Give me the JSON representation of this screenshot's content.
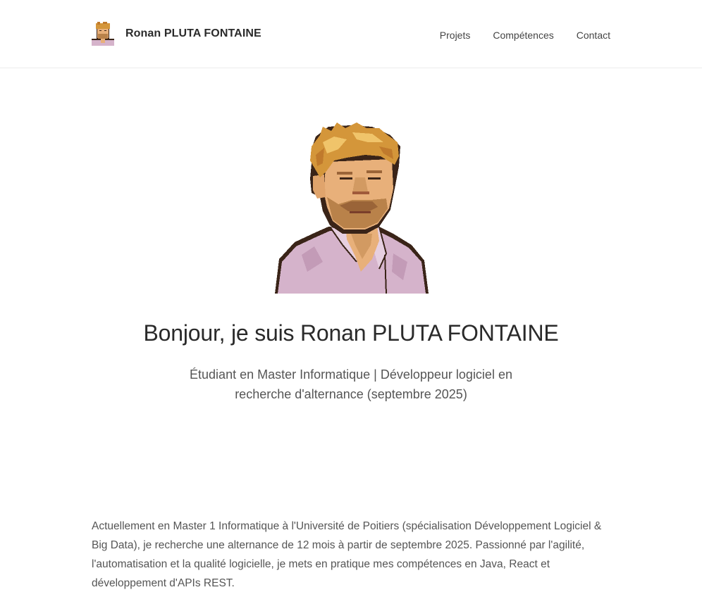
{
  "header": {
    "name": "Ronan PLUTA FONTAINE",
    "nav": [
      {
        "label": "Projets"
      },
      {
        "label": "Compétences"
      },
      {
        "label": "Contact"
      }
    ]
  },
  "hero": {
    "title": "Bonjour, je suis Ronan PLUTA FONTAINE",
    "subtitle": "Étudiant en Master Informatique | Développeur logiciel en recherche d'alternance (septembre 2025)"
  },
  "intro": {
    "text": "Actuellement en Master 1 Informatique à l'Université de Poitiers (spécialisation Développement Logiciel & Big Data), je recherche une alternance de 12 mois à partir de septembre 2025. Passionné par l'agilité, l'automatisation et la qualité logicielle, je mets en pratique mes compétences en Java, React et développement d'APIs REST."
  },
  "colors": {
    "shirt": "#d5b3cb",
    "hair": "#d4963a",
    "skin": "#e8b07a",
    "outline": "#3a2418"
  }
}
